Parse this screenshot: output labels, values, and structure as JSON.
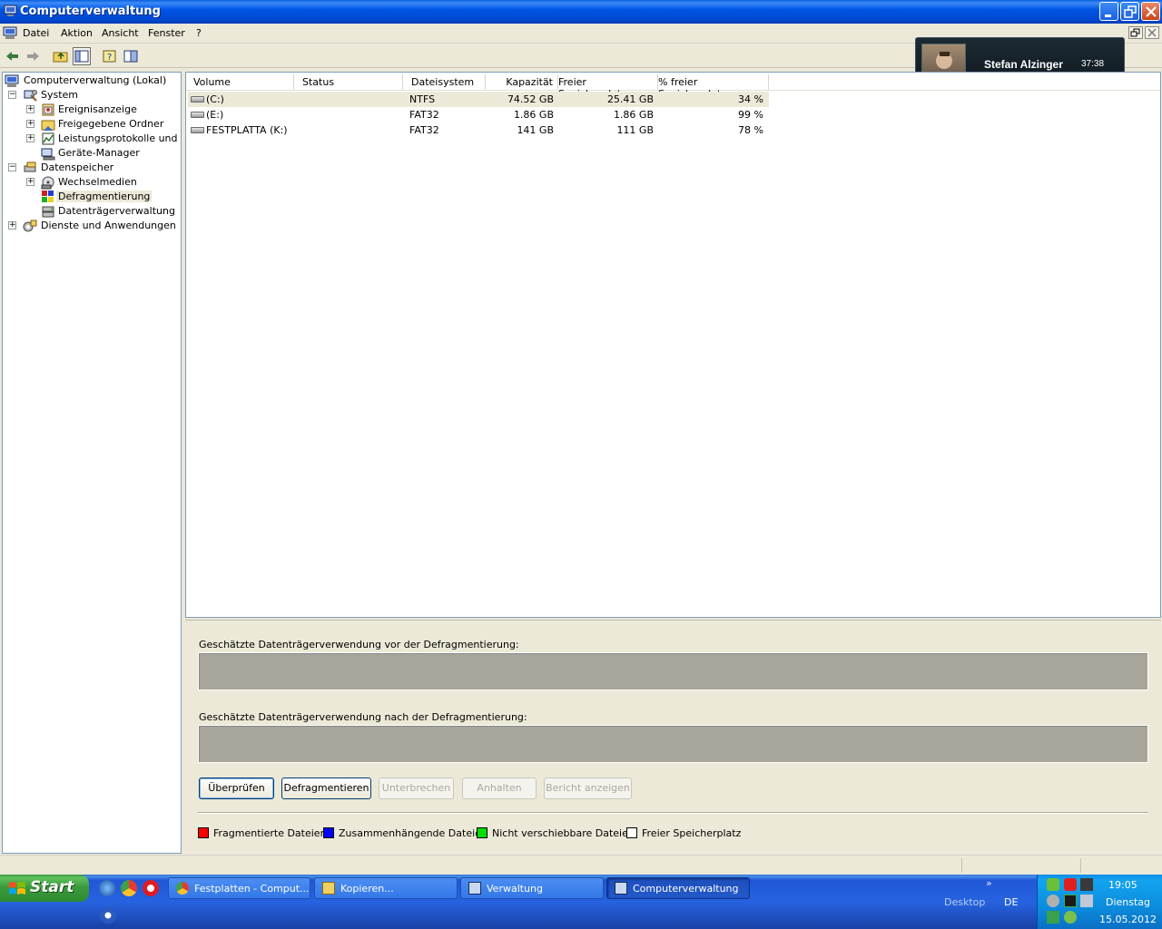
{
  "window": {
    "title": "Computerverwaltung"
  },
  "menu": {
    "items": [
      "Datei",
      "Aktion",
      "Ansicht",
      "Fenster",
      "?"
    ]
  },
  "overlay": {
    "name": "Stefan Alzinger",
    "time": "37:38"
  },
  "tree": {
    "items": [
      {
        "label": "Computerverwaltung (Lokal)"
      },
      {
        "label": "System"
      },
      {
        "label": "Ereignisanzeige"
      },
      {
        "label": "Freigegebene Ordner"
      },
      {
        "label": "Leistungsprotokolle und Warnungen"
      },
      {
        "label": "Geräte-Manager"
      },
      {
        "label": "Datenspeicher"
      },
      {
        "label": "Wechselmedien"
      },
      {
        "label": "Defragmentierung"
      },
      {
        "label": "Datenträgerverwaltung"
      },
      {
        "label": "Dienste und Anwendungen"
      }
    ]
  },
  "list": {
    "columns": [
      "Volume",
      "Status",
      "Dateisystem",
      "Kapazität",
      "Freier Speicherplatz",
      "% freier Speicherplatz"
    ],
    "rows": [
      {
        "volume": "(C:)",
        "status": "",
        "fs": "NTFS",
        "capacity": "74.52 GB",
        "free": "25.41 GB",
        "pct": "34 %"
      },
      {
        "volume": "(E:)",
        "status": "",
        "fs": "FAT32",
        "capacity": "1.86 GB",
        "free": "1.86 GB",
        "pct": "99 %"
      },
      {
        "volume": "FESTPLATTA (K:)",
        "status": "",
        "fs": "FAT32",
        "capacity": "141 GB",
        "free": "111 GB",
        "pct": "78 %"
      }
    ]
  },
  "analysis": {
    "before_label": "Geschätzte Datenträgerverwendung vor der Defragmentierung:",
    "after_label": "Geschätzte Datenträgerverwendung nach der Defragmentierung:",
    "buttons": {
      "check": "Überprüfen",
      "defrag": "Defragmentieren",
      "interrupt": "Unterbrechen",
      "pause": "Anhalten",
      "report": "Bericht anzeigen"
    },
    "legend": [
      {
        "label": "Fragmentierte Dateien",
        "color": "#ff0000"
      },
      {
        "label": "Zusammenhängende Dateien",
        "color": "#0000ff"
      },
      {
        "label": "Nicht verschiebbare Dateien",
        "color": "#00dd00"
      },
      {
        "label": "Freier Speicherplatz",
        "color": "#ffffff"
      }
    ]
  },
  "taskbar": {
    "start_label": "Start",
    "tasks": [
      {
        "label": "Festplatten - Comput..."
      },
      {
        "label": "Kopieren..."
      },
      {
        "label": "Verwaltung"
      },
      {
        "label": "Computerverwaltung"
      }
    ],
    "desktop_label": "Desktop",
    "language": "DE",
    "chevron": "»",
    "clock": "19:05",
    "day": "Dienstag",
    "date": "15.05.2012"
  }
}
